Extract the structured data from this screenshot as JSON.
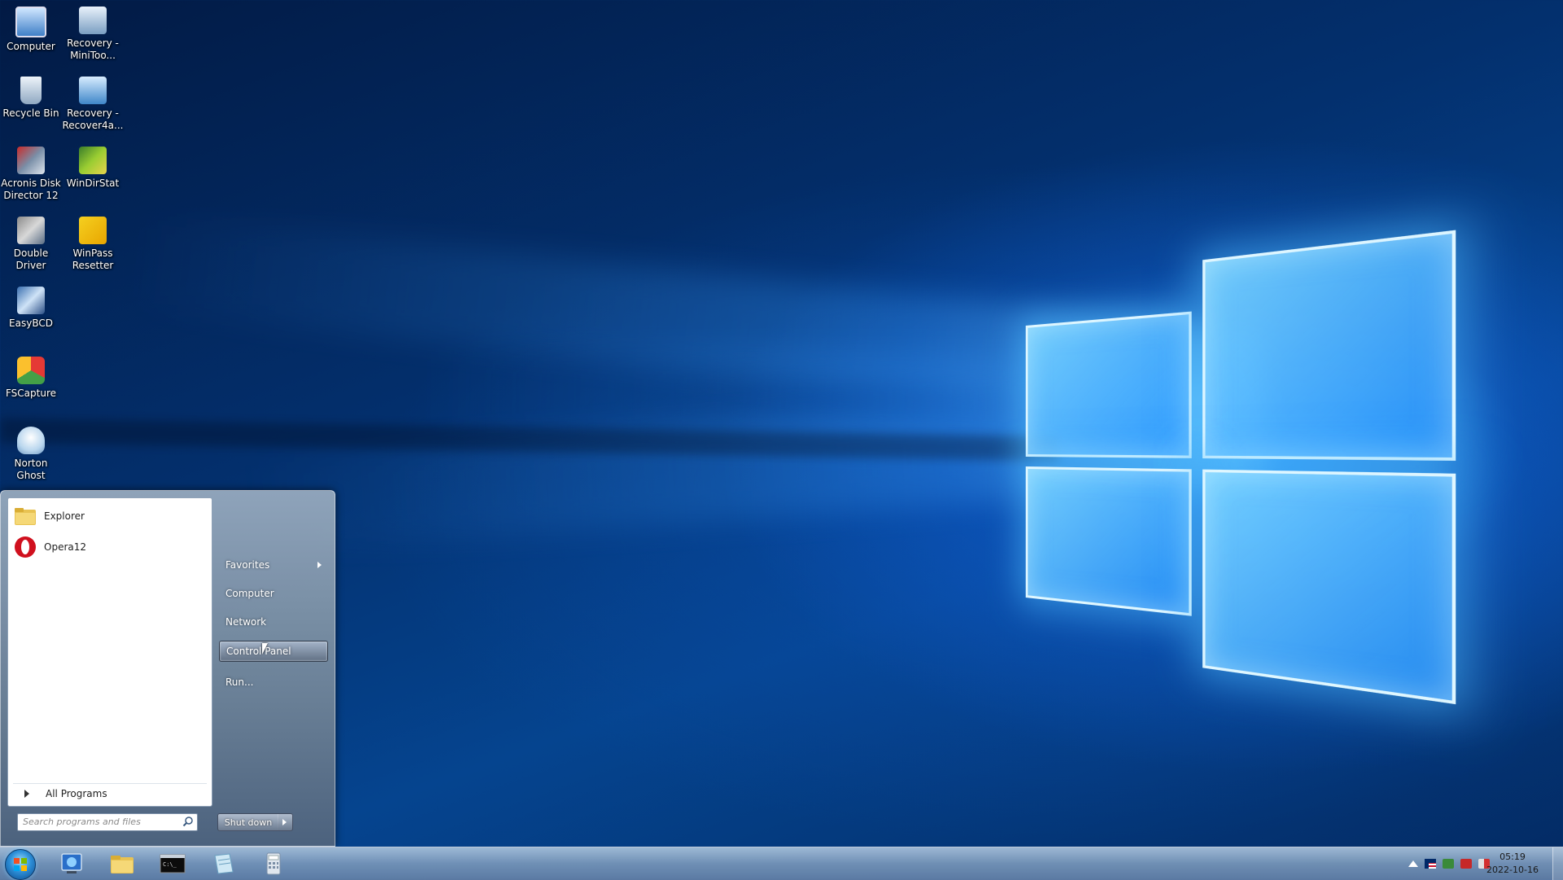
{
  "desktop": {
    "icons": [
      {
        "label": "Computer",
        "icon": "computer-icon"
      },
      {
        "label": "Recovery - MiniToo...",
        "icon": "recovery-shortcut-icon"
      },
      {
        "label": "Recycle Bin",
        "icon": "recycle-bin-icon"
      },
      {
        "label": "Recovery - Recover4a...",
        "icon": "recovery-shortcut-icon"
      },
      {
        "label": "Acronis Disk Director 12",
        "icon": "acronis-icon"
      },
      {
        "label": "WinDirStat",
        "icon": "windirstat-icon"
      },
      {
        "label": "Double Driver",
        "icon": "double-driver-icon"
      },
      {
        "label": "WinPass Resetter",
        "icon": "winpass-icon"
      },
      {
        "label": "EasyBCD",
        "icon": "easybcd-icon"
      },
      {
        "label": "FSCapture",
        "icon": "fscapture-icon"
      },
      {
        "label": "Norton Ghost",
        "icon": "norton-ghost-icon"
      }
    ]
  },
  "start_menu": {
    "programs": [
      {
        "label": "Explorer",
        "icon": "folder-icon"
      },
      {
        "label": "Opera12",
        "icon": "opera-icon"
      }
    ],
    "all_programs": "All Programs",
    "search_placeholder": "Search programs and files",
    "right_items": {
      "favorites": "Favorites",
      "computer": "Computer",
      "network": "Network",
      "control_panel": "Control Panel",
      "run": "Run..."
    },
    "shutdown": "Shut down"
  },
  "taskbar": {
    "pinned": [
      {
        "name": "ie-icon"
      },
      {
        "name": "explorer-folder-icon"
      },
      {
        "name": "cmd-icon"
      },
      {
        "name": "notepad-icon"
      },
      {
        "name": "calculator-icon"
      }
    ],
    "clock": {
      "time": "05:19",
      "date": "2022-10-16"
    }
  },
  "colors": {
    "accent": "#2d8fd8",
    "desktop_bg": "#03306e",
    "logo_glow": "#78d2ff"
  }
}
